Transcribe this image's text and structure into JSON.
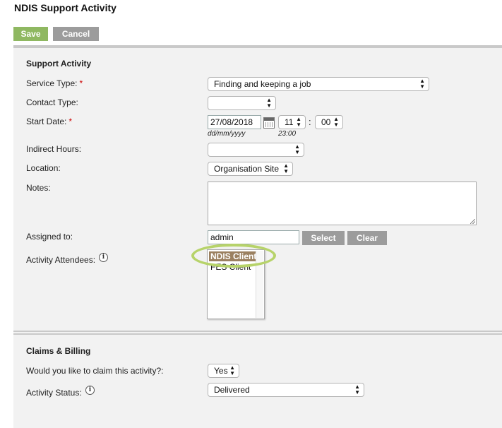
{
  "page": {
    "title": "NDIS Support Activity"
  },
  "actions": {
    "save_label": "Save",
    "cancel_label": "Cancel"
  },
  "support_activity": {
    "section_title": "Support Activity",
    "service_type": {
      "label": "Service Type:",
      "required": "*",
      "value": "Finding and keeping a job"
    },
    "contact_type": {
      "label": "Contact Type:",
      "value": ""
    },
    "start_date": {
      "label": "Start Date:",
      "required": "*",
      "date_value": "27/08/2018",
      "date_hint": "dd/mm/yyyy",
      "hour_value": "11",
      "minute_value": "00",
      "time_hint": "23:00",
      "separator": ":"
    },
    "indirect_hours": {
      "label": "Indirect Hours:",
      "value": ""
    },
    "location": {
      "label": "Location:",
      "value": "Organisation Site"
    },
    "notes": {
      "label": "Notes:",
      "value": ""
    },
    "assigned_to": {
      "label": "Assigned to:",
      "value": "admin",
      "select_label": "Select",
      "clear_label": "Clear"
    },
    "activity_attendees": {
      "label": "Activity Attendees:",
      "options": [
        "NDIS Client",
        "FES Client"
      ],
      "selected": "NDIS Client"
    }
  },
  "claims_billing": {
    "section_title": "Claims & Billing",
    "claim": {
      "label": "Would you like to claim this activity?:",
      "value": "Yes"
    },
    "activity_status": {
      "label": "Activity Status:",
      "value": "Delivered"
    }
  },
  "icons": {
    "info": "info-icon",
    "calendar": "calendar-icon",
    "select_arrows": "updown-arrows-icon"
  },
  "colors": {
    "save": "#8fb861",
    "cancel": "#9c9c9c",
    "selected_item": "#9b8060",
    "highlight_ring": "#b7d36a",
    "panel_bg": "#f2f2f2"
  }
}
